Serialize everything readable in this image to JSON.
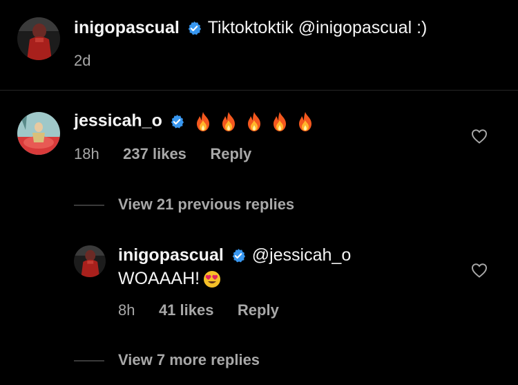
{
  "caption": {
    "username": "inigopascual",
    "text": "Tiktoktoktik @inigopascual :)",
    "time": "2d"
  },
  "comment": {
    "username": "jessicah_o",
    "emoji_count": 5,
    "emoji_icon": "fire-icon",
    "time": "18h",
    "likes": "237 likes",
    "reply_label": "Reply"
  },
  "view_previous": "View 21 previous replies",
  "reply": {
    "username": "inigopascual",
    "mention": "@jessicah_o",
    "text": "WOAAAH!",
    "emoji_icon": "heart-eyes-icon",
    "time": "8h",
    "likes": "41 likes",
    "reply_label": "Reply"
  },
  "view_more": "View 7 more replies",
  "colors": {
    "background": "#000000",
    "text": "#f5f5f5",
    "muted": "#a8a8a8",
    "verified": "#3897f0"
  }
}
